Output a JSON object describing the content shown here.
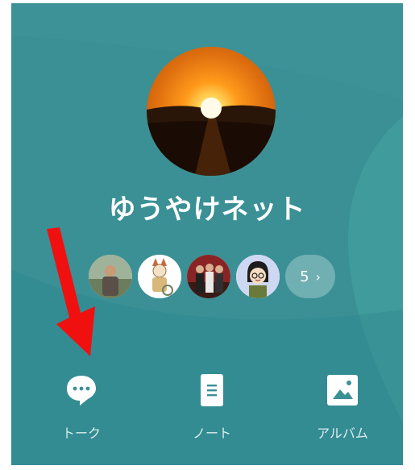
{
  "group": {
    "name": "ゆうやけネット"
  },
  "members": {
    "more_count": "5",
    "more_chevron": "›"
  },
  "actions": [
    {
      "label": "トーク",
      "icon": "chat-bubble-icon"
    },
    {
      "label": "ノート",
      "icon": "note-icon"
    },
    {
      "label": "アルバム",
      "icon": "album-icon"
    }
  ],
  "colors": {
    "background": "#3a9095",
    "annotation_arrow": "#f01010"
  }
}
